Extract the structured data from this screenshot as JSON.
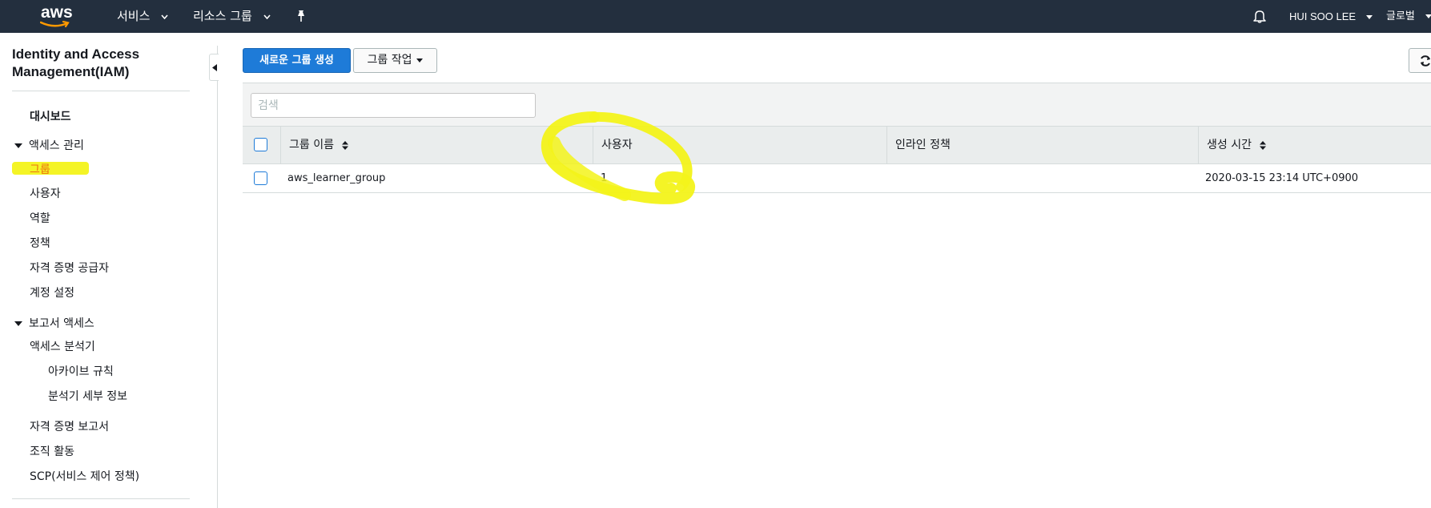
{
  "header": {
    "logo_text": "aws",
    "services_label": "서비스",
    "resource_groups_label": "리소스 그룹",
    "user_label": "HUI SOO LEE",
    "region_label": "글로벌",
    "icons": [
      "pin-icon",
      "bell-icon",
      "chevron-down-icon"
    ]
  },
  "sidebar": {
    "title": "Identity and Access Management(IAM)",
    "dashboard": "대시보드",
    "access_management": {
      "label": "액세스 관리",
      "items": [
        "그룹",
        "사용자",
        "역할",
        "정책",
        "자격 증명 공급자",
        "계정 설정"
      ]
    },
    "access_reports": {
      "label": "보고서 액세스",
      "analyzer": "액세스 분석기",
      "analyzer_sub": [
        "아카이브 규칙",
        "분석기 세부 정보"
      ],
      "items": [
        "자격 증명 보고서",
        "조직 활동",
        "SCP(서비스 제어 정책)"
      ]
    },
    "active_item": "그룹",
    "highlight_color": "#f3f31a"
  },
  "toolbar": {
    "create_group_label": "새로운 그룹 생성",
    "group_actions_label": "그룹 작업"
  },
  "search": {
    "placeholder": "검색"
  },
  "table": {
    "columns": [
      "그룹 이름",
      "사용자",
      "인라인 정책",
      "생성 시간"
    ],
    "rows": [
      {
        "group_name": "aws_learner_group",
        "users": "1",
        "inline_policy": "",
        "created": "2020-03-15 23:14 UTC+0900"
      }
    ]
  },
  "colors": {
    "nav_bg": "#232f3e",
    "primary_button": "#1e7bd8",
    "annotation_yellow": "#f3f31a"
  }
}
